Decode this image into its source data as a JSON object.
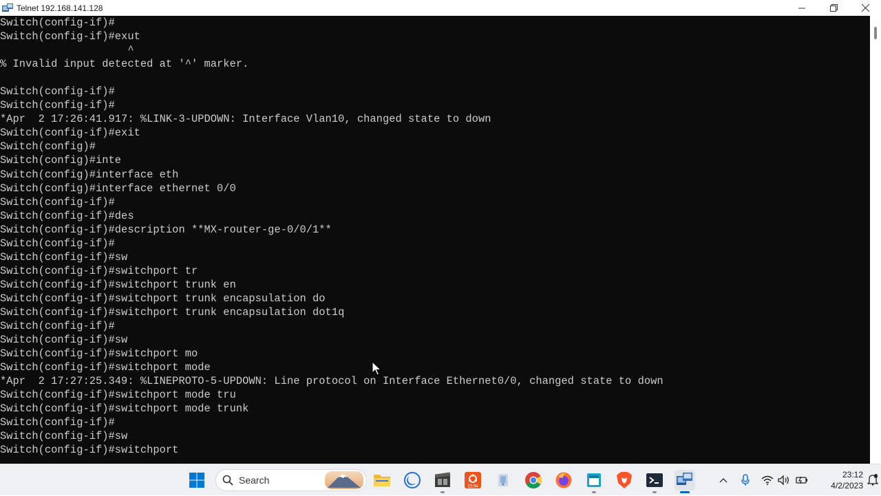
{
  "window": {
    "title": "Telnet 192.168.141.128"
  },
  "terminal": {
    "lines": [
      "Switch(config-if)#",
      "Switch(config-if)#exut",
      "                    ^",
      "% Invalid input detected at '^' marker.",
      "",
      "Switch(config-if)#",
      "Switch(config-if)#",
      "*Apr  2 17:26:41.917: %LINK-3-UPDOWN: Interface Vlan10, changed state to down",
      "Switch(config-if)#exit",
      "Switch(config)#",
      "Switch(config)#inte",
      "Switch(config)#interface eth",
      "Switch(config)#interface ethernet 0/0",
      "Switch(config-if)#",
      "Switch(config-if)#des",
      "Switch(config-if)#description **MX-router-ge-0/0/1**",
      "Switch(config-if)#",
      "Switch(config-if)#sw",
      "Switch(config-if)#switchport tr",
      "Switch(config-if)#switchport trunk en",
      "Switch(config-if)#switchport trunk encapsulation do",
      "Switch(config-if)#switchport trunk encapsulation dot1q",
      "Switch(config-if)#",
      "Switch(config-if)#sw",
      "Switch(config-if)#switchport mo",
      "Switch(config-if)#switchport mode",
      "*Apr  2 17:27:25.349: %LINEPROTO-5-UPDOWN: Line protocol on Interface Ethernet0/0, changed state to down",
      "Switch(config-if)#switchport mode tru",
      "Switch(config-if)#switchport mode trunk",
      "Switch(config-if)#",
      "Switch(config-if)#sw",
      "Switch(config-if)#switchport"
    ]
  },
  "taskbar": {
    "search_label": "Search",
    "clock_time": "23:12",
    "clock_date": "4/2/2023",
    "apps": [
      {
        "name": "start-button",
        "icon": "windows-logo-icon"
      },
      {
        "name": "mount-fuji-widget",
        "icon": "mount-fuji-icon"
      },
      {
        "name": "file-explorer",
        "icon": "folder-icon"
      },
      {
        "name": "app-crescent",
        "icon": "crescent-icon"
      },
      {
        "name": "app-film",
        "icon": "film-icon"
      },
      {
        "name": "app-ubuntu-2204",
        "icon": "ubuntu-icon"
      },
      {
        "name": "app-cloud",
        "icon": "cloud-icon"
      },
      {
        "name": "chrome",
        "icon": "chrome-icon"
      },
      {
        "name": "firefox",
        "icon": "firefox-icon"
      },
      {
        "name": "app-window",
        "icon": "window-icon"
      },
      {
        "name": "brave",
        "icon": "brave-icon"
      },
      {
        "name": "terminal",
        "icon": "terminal-icon"
      },
      {
        "name": "telnet-active",
        "icon": "telnet-icon"
      }
    ]
  },
  "colors": {
    "terminal_bg": "#0c0c0c",
    "terminal_fg": "#cccccc",
    "taskbar_bg": "#eef0f4",
    "accent": "#0067c0"
  }
}
